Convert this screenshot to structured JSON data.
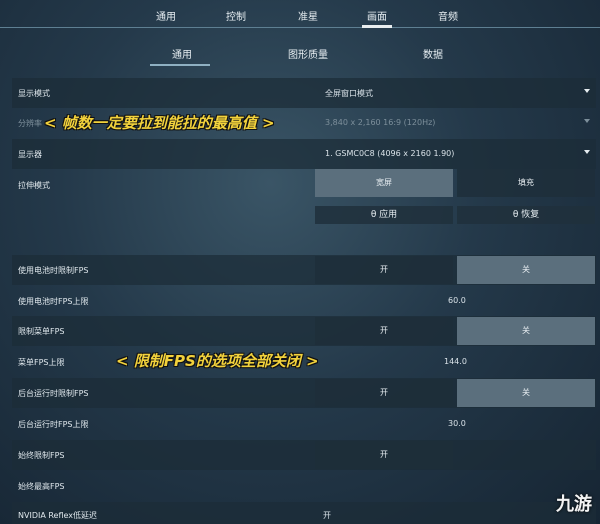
{
  "top_tabs": [
    "通用",
    "控制",
    "准星",
    "画面",
    "音频"
  ],
  "sub_tabs": [
    "通用",
    "图形质量",
    "数据"
  ],
  "settings": {
    "display_mode": {
      "label": "显示模式",
      "value": "全屏窗口模式"
    },
    "resolution": {
      "label": "分辨率",
      "value": "3,840 x 2,160 16:9 (120Hz)"
    },
    "monitor": {
      "label": "显示器",
      "value": "1. GSMC0C8 (4096 x 2160 1.90)"
    },
    "stretch": {
      "label": "拉伸模式",
      "opt1": "宽屏",
      "opt2": "填充"
    },
    "apply": "θ 应用",
    "restore": "θ 恢复",
    "battery_limit": {
      "label": "使用电池时限制FPS",
      "on": "开",
      "off": "关"
    },
    "battery_cap": {
      "label": "使用电池时FPS上限",
      "value": "60.0"
    },
    "menu_limit": {
      "label": "限制菜单FPS",
      "on": "开",
      "off": "关"
    },
    "menu_cap": {
      "label": "菜单FPS上限",
      "value": "144.0"
    },
    "bg_limit": {
      "label": "后台运行时限制FPS",
      "on": "开",
      "off": "关"
    },
    "bg_cap": {
      "label": "后台运行时FPS上限",
      "value": "30.0"
    },
    "always_limit": {
      "label": "始终限制FPS",
      "on": "开"
    },
    "always_cap": {
      "label": "始终最高FPS"
    },
    "reflex": {
      "label": "NVIDIA Reflex低延迟",
      "value": "开"
    }
  },
  "annotations": {
    "fps_note": "< 帧数一定要拉到能拉的最高值 >",
    "limit_note": "< 限制FPS的选项全部关闭 >"
  },
  "watermark": "九游"
}
